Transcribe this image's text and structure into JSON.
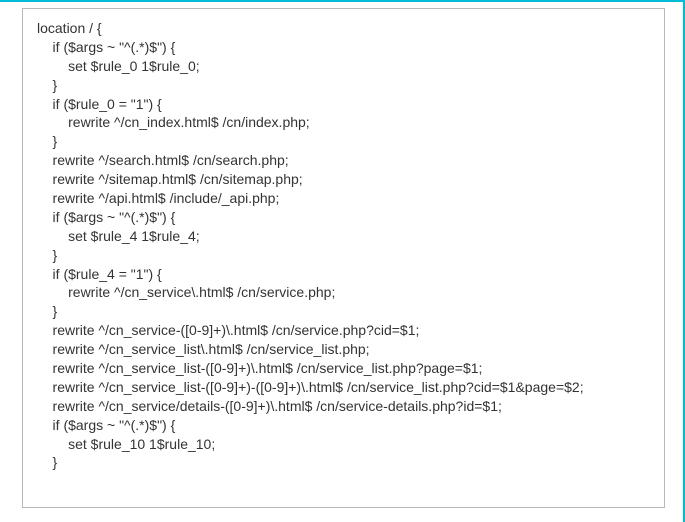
{
  "code": {
    "lines": [
      "location / {",
      "    if ($args ~ \"^(.*)$\") {",
      "        set $rule_0 1$rule_0;",
      "    }",
      "",
      "    if ($rule_0 = \"1\") {",
      "        rewrite ^/cn_index.html$ /cn/index.php;",
      "    }",
      "    rewrite ^/search.html$ /cn/search.php;",
      "    rewrite ^/sitemap.html$ /cn/sitemap.php;",
      "    rewrite ^/api.html$ /include/_api.php;",
      "",
      "    if ($args ~ \"^(.*)$\") {",
      "        set $rule_4 1$rule_4;",
      "    }",
      "",
      "    if ($rule_4 = \"1\") {",
      "        rewrite ^/cn_service\\.html$ /cn/service.php;",
      "    }",
      "    rewrite ^/cn_service-([0-9]+)\\.html$ /cn/service.php?cid=$1;",
      "    rewrite ^/cn_service_list\\.html$ /cn/service_list.php;",
      "    rewrite ^/cn_service_list-([0-9]+)\\.html$ /cn/service_list.php?page=$1;",
      "    rewrite ^/cn_service_list-([0-9]+)-([0-9]+)\\.html$ /cn/service_list.php?cid=$1&page=$2;",
      "    rewrite ^/cn_service/details-([0-9]+)\\.html$ /cn/service-details.php?id=$1;",
      "",
      "    if ($args ~ \"^(.*)$\") {",
      "        set $rule_10 1$rule_10;",
      "    }"
    ]
  }
}
